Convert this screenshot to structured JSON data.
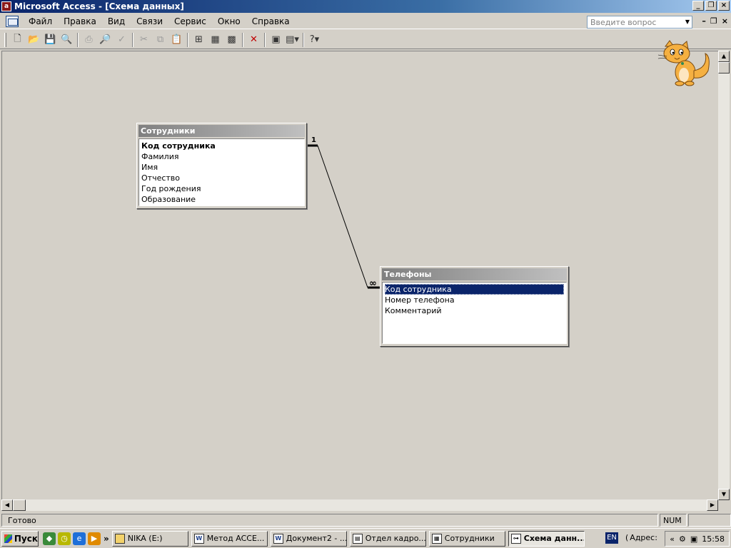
{
  "window": {
    "title": "Microsoft Access - [Схема данных]",
    "controls": [
      "_",
      "❐",
      "×"
    ]
  },
  "menu": {
    "items": [
      "Файл",
      "Правка",
      "Вид",
      "Связи",
      "Сервис",
      "Окно",
      "Справка"
    ],
    "help_placeholder": "Введите вопрос",
    "mdi_controls": [
      "–",
      "❐",
      "×"
    ]
  },
  "toolbar": {
    "icons": [
      "new-icon",
      "open-icon",
      "save-icon",
      "print-preview-icon",
      "print-icon",
      "preview-icon",
      "spelling-icon",
      "cut-icon",
      "copy-icon",
      "paste-icon",
      "show-table-icon",
      "direct-relationships-icon",
      "all-relationships-icon",
      "delete-icon",
      "database-window-icon",
      "new-object-icon",
      "help-icon"
    ]
  },
  "diagram": {
    "tables": [
      {
        "title": "Сотрудники",
        "fields": [
          "Код сотрудника",
          "Фамилия",
          "Имя",
          "Отчество",
          "Год рождения",
          "Образование"
        ],
        "key_field": "Код сотрудника"
      },
      {
        "title": "Телефоны",
        "fields": [
          "Код сотрудника",
          "Номер телефона",
          "Комментарий"
        ],
        "selected_field": "Код сотрудника"
      }
    ],
    "relationship": {
      "from_label": "1",
      "to_label": "∞"
    }
  },
  "status": {
    "text": "Готово",
    "num": "NUM"
  },
  "taskbar": {
    "start_label": "Пуск",
    "chevron": "»",
    "tasks": [
      {
        "label": "NIKA (E:)",
        "active": false
      },
      {
        "label": "Метод ACCE...",
        "active": false
      },
      {
        "label": "Документ2 - ...",
        "active": false
      },
      {
        "label": "Отдел кадро...",
        "active": false
      },
      {
        "label": "Сотрудники",
        "active": false
      },
      {
        "label": "Схема данн...",
        "active": true
      }
    ],
    "lang": "EN",
    "address_label": "Адрес:",
    "tray_chevron": "«",
    "time": "15:58"
  }
}
